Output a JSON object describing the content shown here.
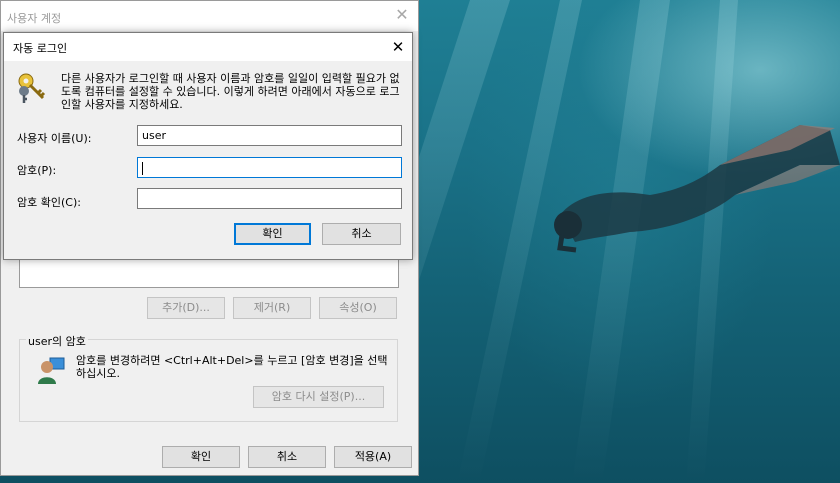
{
  "back_window": {
    "title": "사용자 계정",
    "buttons": {
      "add_label": "추가(D)...",
      "remove_label": "제거(R)",
      "properties_label": "속성(O)"
    },
    "password_group": {
      "legend": "user의 암호",
      "text": "암호를 변경하려면 <Ctrl+Alt+Del>를 누르고 [암호 변경]을 선택하십시오.",
      "reset_label": "암호 다시 설정(P)..."
    },
    "footer": {
      "ok_label": "확인",
      "cancel_label": "취소",
      "apply_label": "적용(A)"
    }
  },
  "dialog": {
    "title": "자동 로그인",
    "description": "다른 사용자가 로그인할 때 사용자 이름과 암호를 일일이 입력할 필요가 없도록 컴퓨터를 설정할 수 있습니다. 이렇게 하려면 아래에서 자동으로 로그인할 사용자를 지정하세요.",
    "fields": {
      "username_label": "사용자 이름(U):",
      "username_value": "user",
      "password_label": "암호(P):",
      "password_value": "",
      "confirm_label": "암호 확인(C):",
      "confirm_value": ""
    },
    "ok_label": "확인",
    "cancel_label": "취소"
  },
  "icons": {
    "dialog_close": "close-icon",
    "keys": "keys-icon",
    "user": "user-icon"
  },
  "colors": {
    "accent": "#0078d7",
    "dialog_bg": "#f0f0f0",
    "wallpaper": "#1a7288"
  }
}
